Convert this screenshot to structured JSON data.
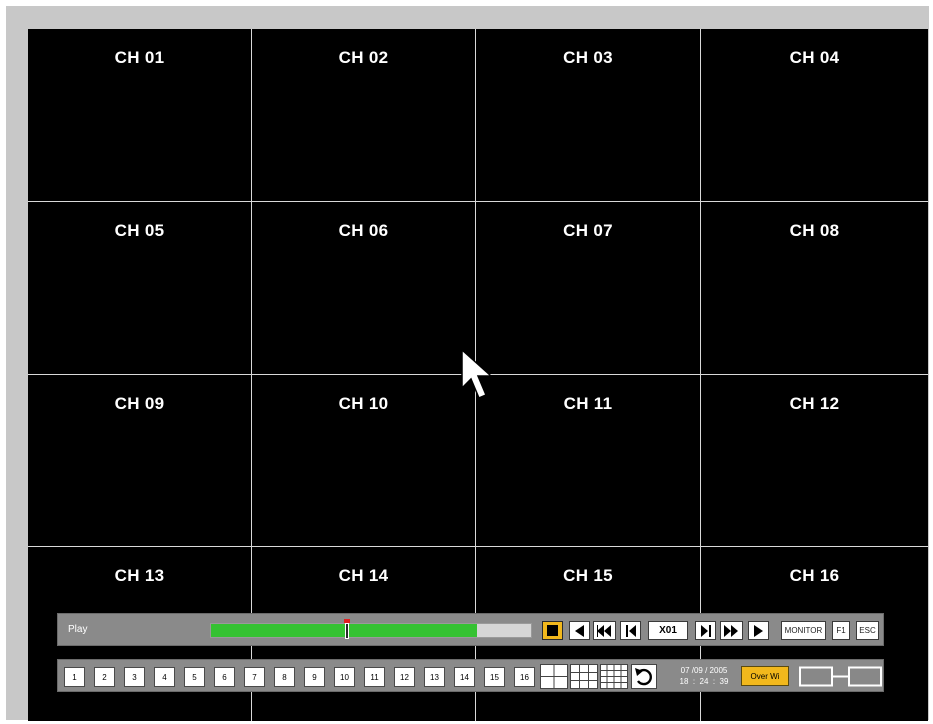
{
  "channels": [
    "CH 01",
    "CH 02",
    "CH 03",
    "CH 04",
    "CH 05",
    "CH 06",
    "CH 07",
    "CH 08",
    "CH 09",
    "CH 10",
    "CH 11",
    "CH 12",
    "CH 13",
    "CH 14",
    "CH 15",
    "CH 16"
  ],
  "playback": {
    "mode_label": "Play",
    "progress_fraction": 0.83,
    "position_fraction": 0.425,
    "speed": "X01",
    "monitor_label": "MONITOR",
    "f1_label": "F1",
    "esc_label": "ESC"
  },
  "channel_buttons": [
    "1",
    "2",
    "3",
    "4",
    "5",
    "6",
    "7",
    "8",
    "9",
    "10",
    "11",
    "12",
    "13",
    "14",
    "15",
    "16"
  ],
  "status": {
    "date": "07 /09 / 2005",
    "time": "18  :  24  :  39",
    "overwrite_label": "Over Wi"
  },
  "colors": {
    "progress": "#35c232",
    "accent": "#f2b81c",
    "marker": "#e02020"
  },
  "icons": [
    "stop-icon",
    "step-back-icon",
    "fast-rewind-icon",
    "frame-back-icon",
    "frame-forward-icon",
    "fast-forward-icon",
    "play-icon",
    "layout-quad-icon",
    "layout-9-icon",
    "layout-16-icon",
    "undo-icon",
    "hdd-status-icon",
    "mouse-cursor-icon"
  ]
}
